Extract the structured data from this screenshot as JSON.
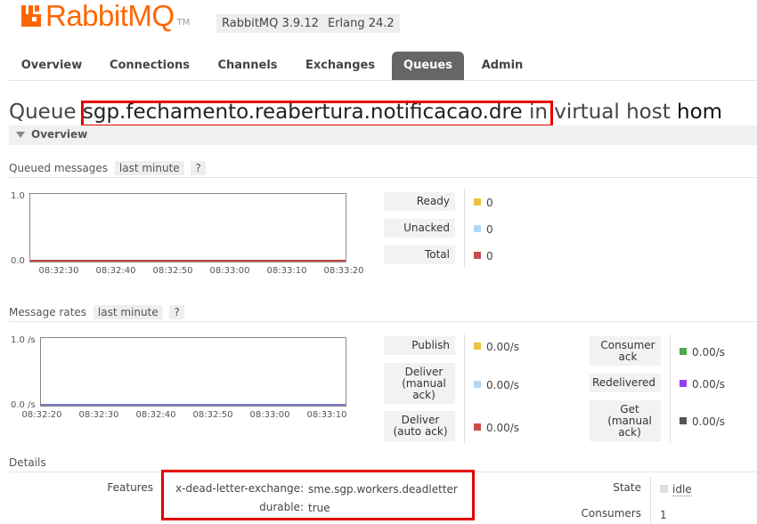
{
  "header": {
    "logo_text": "RabbitMQ",
    "logo_tm": "TM",
    "version_rabbit": "RabbitMQ 3.9.12",
    "version_erlang": "Erlang 24.2",
    "brand_color": "#ff6600"
  },
  "tabs": [
    {
      "label": "Overview",
      "active": false
    },
    {
      "label": "Connections",
      "active": false
    },
    {
      "label": "Channels",
      "active": false
    },
    {
      "label": "Exchanges",
      "active": false
    },
    {
      "label": "Queues",
      "active": true
    },
    {
      "label": "Admin",
      "active": false
    }
  ],
  "page": {
    "title_prefix": "Queue",
    "queue_name": "sgp.fechamento.reabertura.notificacao.dre",
    "title_mid": "in virtual host",
    "vhost": "hom",
    "section_label": "Overview"
  },
  "queued_messages": {
    "title": "Queued messages",
    "range": "last minute",
    "help": "?",
    "y_top": "1.0",
    "y_bottom": "0.0",
    "x_ticks": [
      "08:32:30",
      "08:32:40",
      "08:32:50",
      "08:33:00",
      "08:33:10",
      "08:33:20"
    ],
    "legend": [
      {
        "label": "Ready",
        "value": "0",
        "color": "#edc240"
      },
      {
        "label": "Unacked",
        "value": "0",
        "color": "#afd8f8"
      },
      {
        "label": "Total",
        "value": "0",
        "color": "#cb4b4b"
      }
    ]
  },
  "message_rates": {
    "title": "Message rates",
    "range": "last minute",
    "help": "?",
    "y_top": "1.0 /s",
    "y_bottom": "0.0 /s",
    "x_ticks": [
      "08:32:20",
      "08:32:30",
      "08:32:40",
      "08:32:50",
      "08:33:00",
      "08:33:10"
    ],
    "legend_left": [
      {
        "label": "Publish",
        "value": "0.00/s",
        "color": "#edc240"
      },
      {
        "label": "Deliver (manual ack)",
        "value": "0.00/s",
        "color": "#afd8f8"
      },
      {
        "label": "Deliver (auto ack)",
        "value": "0.00/s",
        "color": "#cb4b4b"
      }
    ],
    "legend_right": [
      {
        "label": "Consumer ack",
        "value": "0.00/s",
        "color": "#4da74d"
      },
      {
        "label": "Redelivered",
        "value": "0.00/s",
        "color": "#9440ed"
      },
      {
        "label": "Get (manual ack)",
        "value": "0.00/s",
        "color": "#545454"
      }
    ]
  },
  "details": {
    "title": "Details",
    "features_label": "Features",
    "features": [
      {
        "key": "x-dead-letter-exchange:",
        "value": "sme.sgp.workers.deadletter"
      },
      {
        "key": "durable:",
        "value": "true"
      }
    ],
    "state_label": "State",
    "state_value": "idle",
    "consumers_label": "Consumers",
    "consumers_value": "1"
  }
}
